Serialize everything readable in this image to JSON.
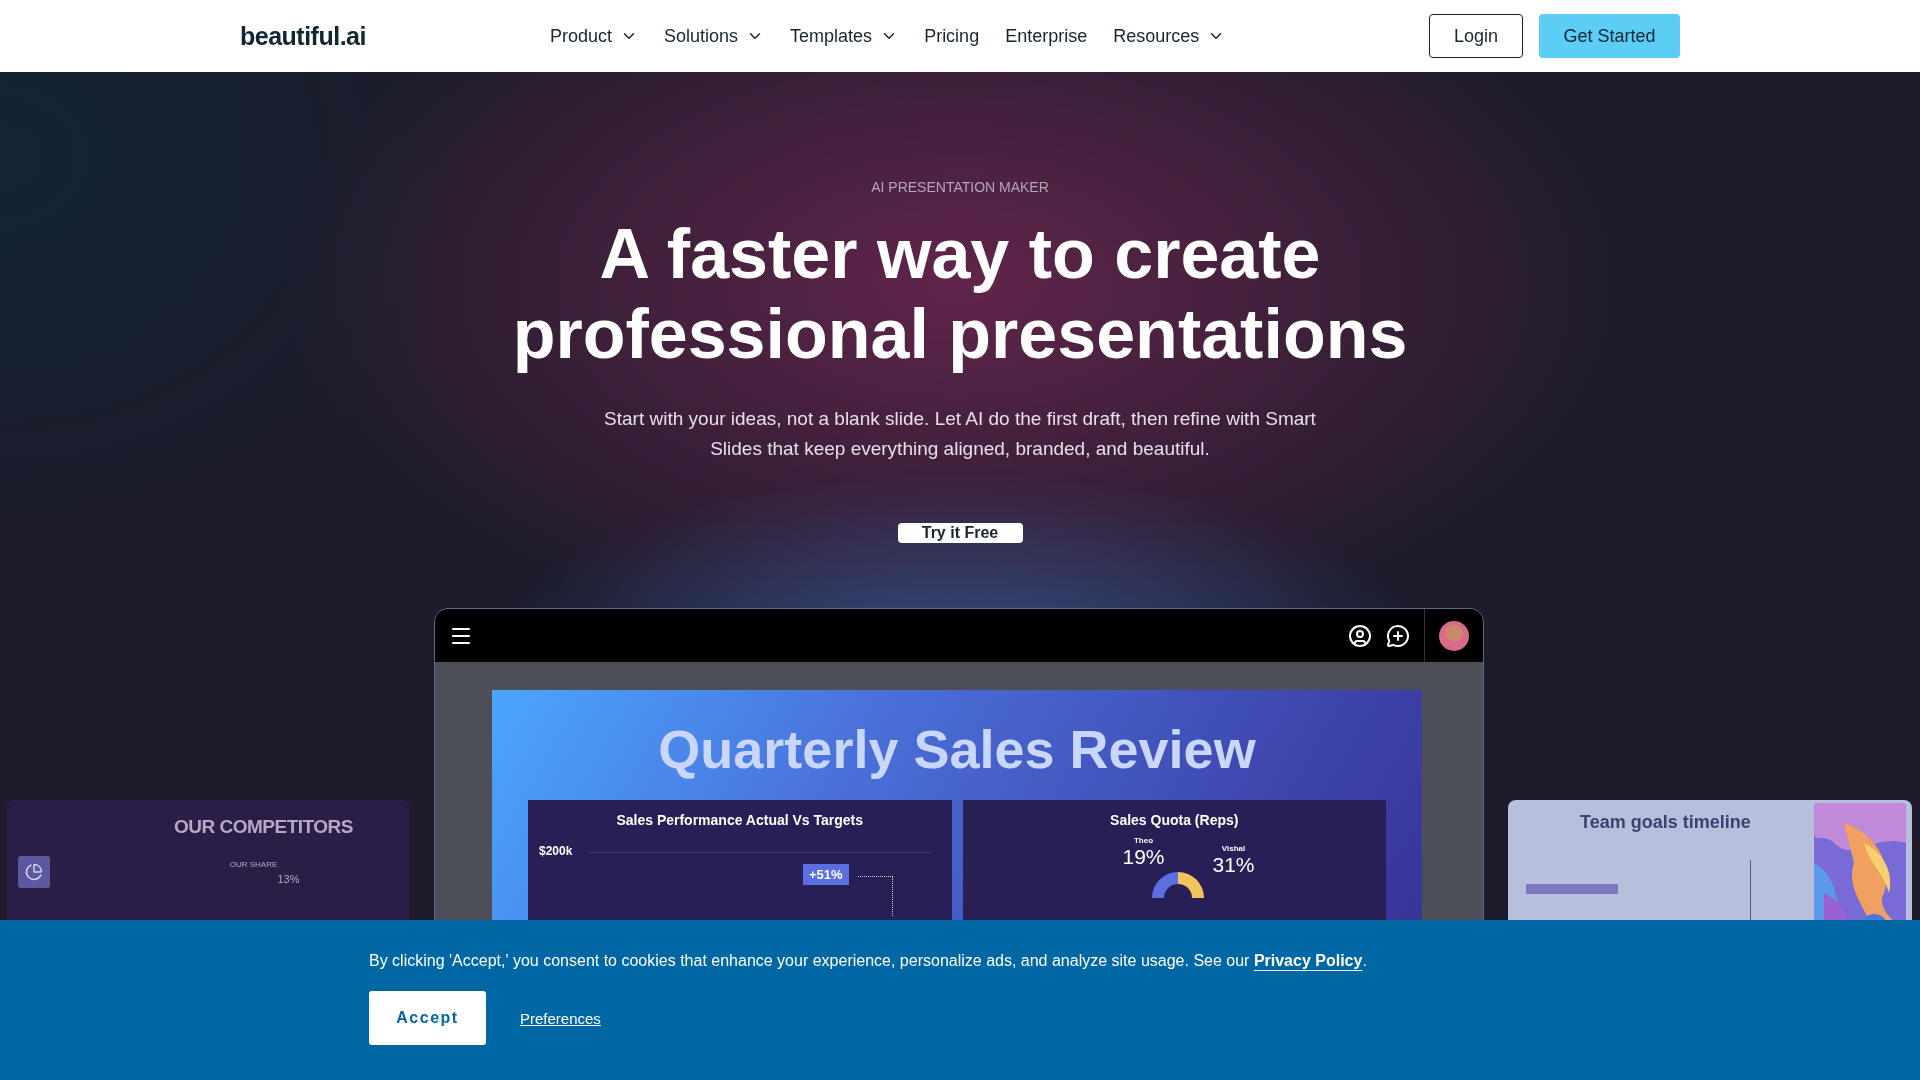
{
  "nav": {
    "logo": "beautiful.ai",
    "items": [
      {
        "label": "Product",
        "kind": "dropdown"
      },
      {
        "label": "Solutions",
        "kind": "dropdown"
      },
      {
        "label": "Templates",
        "kind": "dropdown"
      },
      {
        "label": "Pricing",
        "kind": "link"
      },
      {
        "label": "Enterprise",
        "kind": "link"
      },
      {
        "label": "Resources",
        "kind": "dropdown"
      }
    ],
    "login": "Login",
    "cta": "Get Started"
  },
  "hero": {
    "eyebrow": "AI PRESENTATION MAKER",
    "headline": [
      "A faster way to create",
      "professional presentations"
    ],
    "subtitle": "Start with your ideas, not a blank slide. Let AI do the first draft, then refine with Smart Slides that keep everything aligned, branded, and beautiful.",
    "button": "Try it Free"
  },
  "left_card": {
    "title": "OUR COMPETITORS",
    "label": "OUR SHARE",
    "value": "13%"
  },
  "editor": {
    "slide": {
      "title": "Quarterly Sales Review",
      "panels": [
        {
          "kind": "bars",
          "title": "Sales Performance Actual Vs Targets",
          "tick": "$200k",
          "badge": "+51%"
        },
        {
          "kind": "donut",
          "title": "Sales Quota (Reps)",
          "people": [
            {
              "name": "Theo",
              "value": "19%"
            },
            {
              "name": "Vishal",
              "value": "31%"
            }
          ]
        }
      ]
    }
  },
  "right_card": {
    "title": "Team goals timeline"
  },
  "cookie": {
    "text": "By clicking 'Accept,' you consent to cookies that enhance your experience, personalize ads, and analyze site usage. See our",
    "link": "Privacy Policy",
    "end": ".",
    "accept": "Accept",
    "preferences": "Preferences"
  }
}
